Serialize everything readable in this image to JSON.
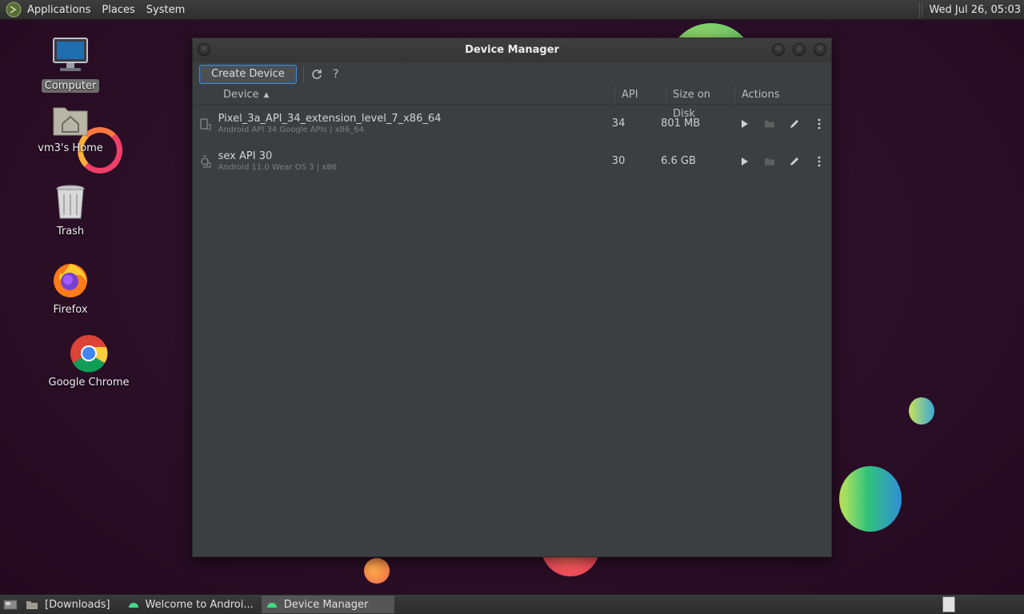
{
  "top_panel": {
    "menus": [
      "Applications",
      "Places",
      "System"
    ],
    "clock": "Wed Jul 26, 05:03"
  },
  "desktop": {
    "icons": [
      {
        "label": "Computer",
        "icon": "computer-icon"
      },
      {
        "label": "vm3's Home",
        "icon": "home-folder-icon"
      },
      {
        "label": "Trash",
        "icon": "trash-icon"
      },
      {
        "label": "Firefox",
        "icon": "firefox-icon"
      },
      {
        "label": "Google Chrome",
        "icon": "chrome-icon"
      }
    ]
  },
  "window": {
    "title": "Device Manager",
    "toolbar": {
      "create_label": "Create Device",
      "refresh_icon": "refresh-icon",
      "help_label": "?"
    },
    "columns": [
      "Device",
      "API",
      "Size on Disk",
      "Actions"
    ],
    "devices": [
      {
        "name": "Pixel_3a_API_34_extension_level_7_x86_64",
        "subtitle": "Android API 34 Google APIs | x86_64",
        "api": "34",
        "size": "801 MB",
        "icon": "phone-icon"
      },
      {
        "name": "sex API 30",
        "subtitle": "Android 11.0 Wear OS 3 | x86",
        "api": "30",
        "size": "6.6 GB",
        "icon": "watch-icon"
      }
    ]
  },
  "taskbar": {
    "items": [
      {
        "label": "[Downloads]",
        "icon": "folder-icon"
      },
      {
        "label": "Welcome to Androi...",
        "icon": "android-icon"
      },
      {
        "label": "Device Manager",
        "icon": "android-icon"
      }
    ]
  },
  "colors": {
    "accent": "#4a88c7",
    "window_bg": "#3c3f41",
    "desktop_bg": "#2a0e26"
  }
}
